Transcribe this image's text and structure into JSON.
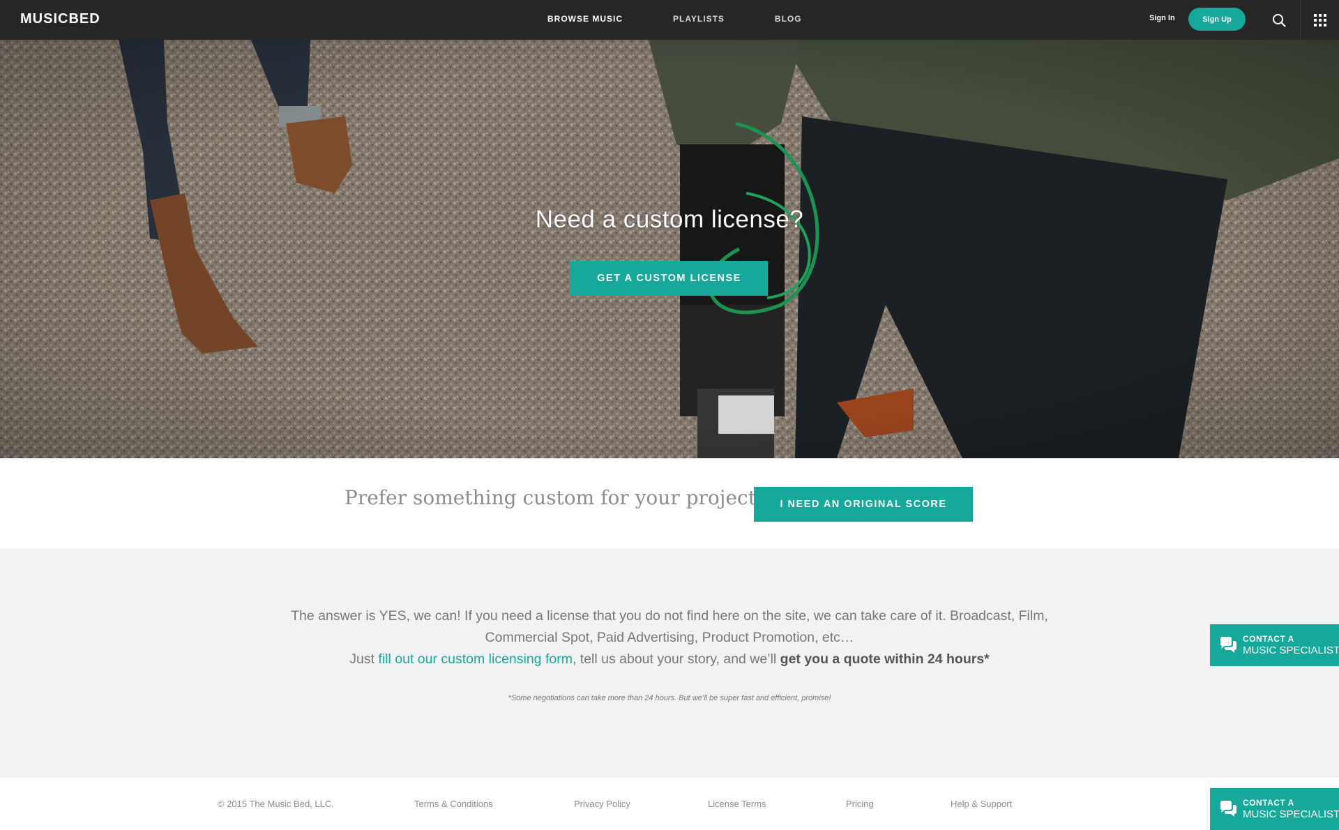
{
  "header": {
    "logo": "MUSICBED",
    "nav": [
      {
        "label": "BROWSE MUSIC"
      },
      {
        "label": "PLAYLISTS"
      },
      {
        "label": "BLOG"
      }
    ],
    "sign_in": "Sign In",
    "sign_up": "Sign Up",
    "icons": [
      "search-icon",
      "apps-grid-icon"
    ]
  },
  "hero": {
    "title": "Need a custom license?",
    "button": "GET A CUSTOM LICENSE"
  },
  "score": {
    "text": "Prefer something custom for your project?",
    "button": "I NEED AN ORIGINAL SCORE"
  },
  "info": {
    "line1": "The answer is YES, we can! If you need a license that you do not find here on the site, we can take care of it. Broadcast, Film,",
    "line2": "Commercial Spot, Paid Advertising, Product Promotion, etc…",
    "line3_pre": "Just ",
    "line3_link": "fill out our custom licensing form",
    "line3_mid": ", tell us about your story, and we’ll ",
    "line3_strong": "get you a quote within 24 hours*",
    "note": "*Some negotiations can take more than 24 hours. But we’ll be super fast and efficient, promise!"
  },
  "footer": {
    "copyright": "© 2015 The Music Bed, LLC.",
    "links": [
      "Terms & Conditions",
      "Privacy Policy",
      "License Terms",
      "Pricing",
      "Help & Support"
    ]
  },
  "contact": {
    "line1": "CONTACT A",
    "line2": "MUSIC SPECIALIST",
    "icon": "chat-bubbles-icon"
  },
  "colors": {
    "accent": "#15a89b",
    "nav_bg": "#262626",
    "info_bg": "#f2f2f2"
  }
}
